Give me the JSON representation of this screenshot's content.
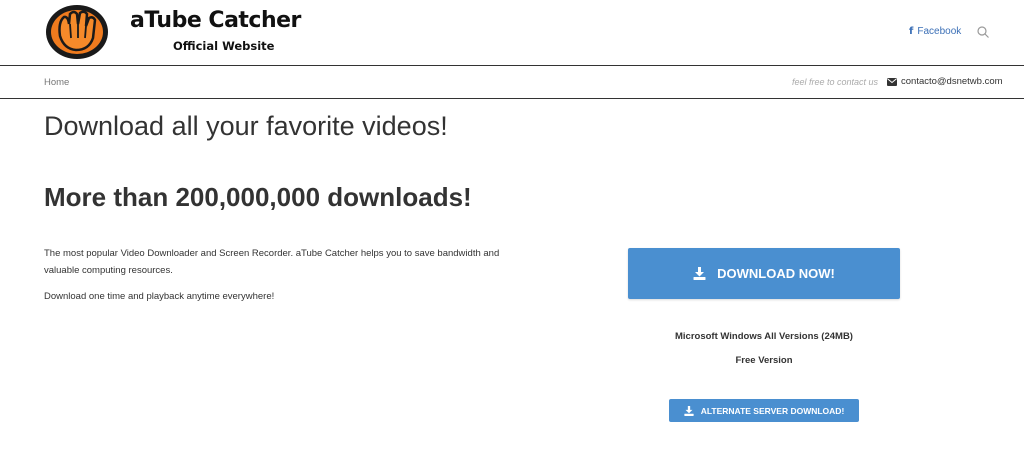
{
  "header": {
    "logo_title": "aTube Catcher",
    "logo_subtitle": "Official Website",
    "facebook_label": "Facebook",
    "icons": {
      "social": "facebook-icon",
      "search": "search-icon",
      "logo": "hand-logo-icon"
    }
  },
  "subbar": {
    "breadcrumb": "Home",
    "contact_note": "feel free to contact us",
    "contact_email": "contacto@dsnetwb.com",
    "icons": {
      "email": "envelope-icon"
    }
  },
  "main": {
    "heading": "Download all your favorite videos!",
    "subheading": "More than 200,000,000 downloads!",
    "paragraphs": [
      "The most popular Video Downloader and Screen Recorder. aTube Catcher helps you to save bandwidth and valuable computing resources.",
      "Download one time and playback anytime everywhere!"
    ]
  },
  "download": {
    "primary_label": "DOWNLOAD NOW!",
    "platform": "Microsoft Windows All Versions (24MB)",
    "edition": "Free Version",
    "alternate_label": "ALTERNATE SERVER DOWNLOAD!",
    "icons": {
      "download": "download-icon"
    }
  },
  "colors": {
    "accent": "#4a8fd0",
    "link": "#3b6fb6",
    "text": "#333333",
    "logo_orange": "#f07b1e"
  }
}
